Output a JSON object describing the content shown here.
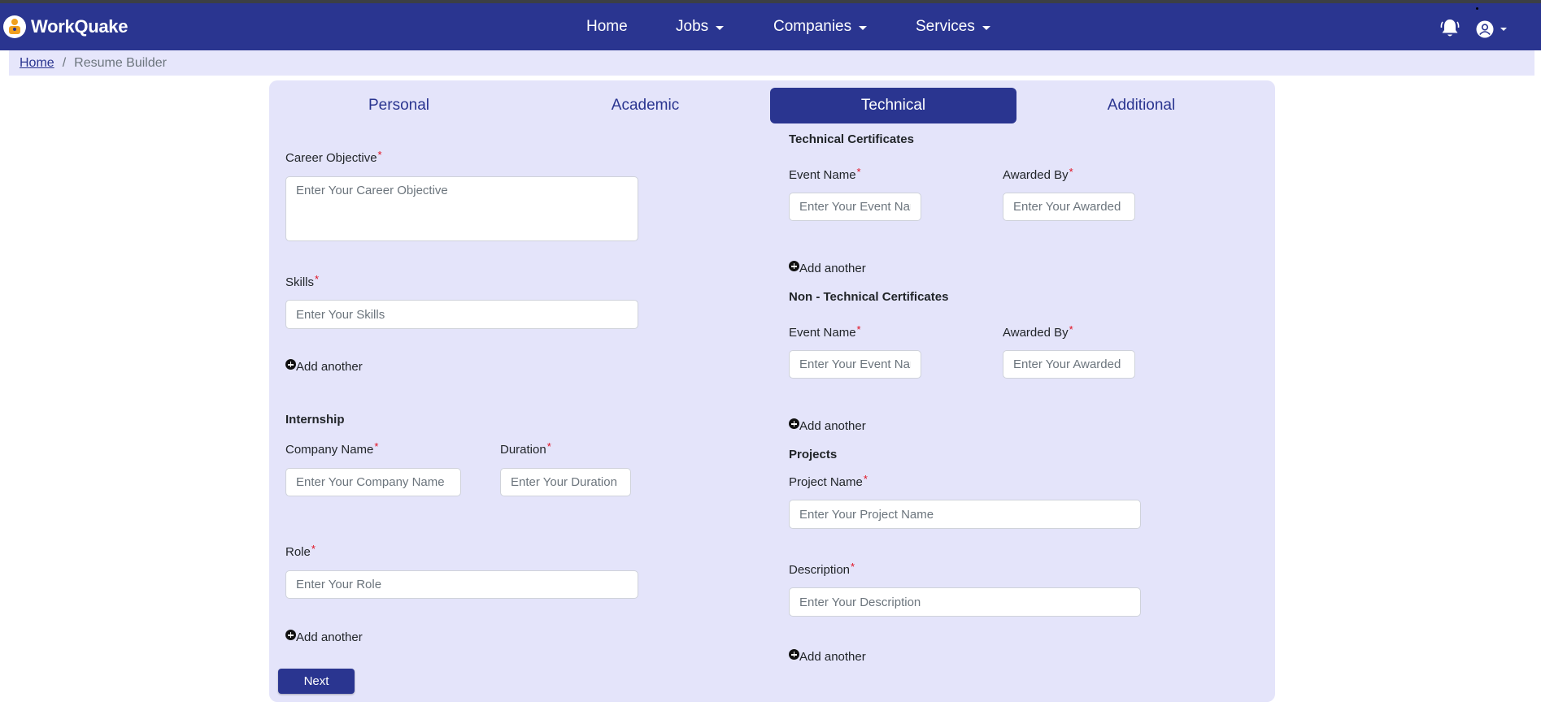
{
  "brand": {
    "name": "WorkQuake"
  },
  "nav": {
    "home": "Home",
    "jobs": "Jobs",
    "companies": "Companies",
    "services": "Services"
  },
  "breadcrumb": {
    "home": "Home",
    "separator": "/",
    "current": "Resume Builder"
  },
  "tabs": {
    "personal": "Personal",
    "academic": "Academic",
    "technical": "Technical",
    "additional": "Additional",
    "active": "Technical"
  },
  "form": {
    "career_objective": {
      "label": "Career Objective",
      "required": "*",
      "placeholder": "Enter Your Career Objective"
    },
    "skills": {
      "label": "Skills",
      "required": "*",
      "placeholder": "Enter Your Skills"
    },
    "add_another": "Add another",
    "internship": {
      "title": "Internship",
      "company_name": {
        "label": "Company Name",
        "required": "*",
        "placeholder": "Enter Your Company Name"
      },
      "duration": {
        "label": "Duration",
        "required": "*",
        "placeholder": "Enter Your Duration"
      },
      "role": {
        "label": "Role",
        "required": "*",
        "placeholder": "Enter Your Role"
      }
    },
    "technical_certificates": {
      "title": "Technical Certificates",
      "event_name": {
        "label": "Event Name",
        "required": "*",
        "placeholder": "Enter Your Event Name"
      },
      "awarded_by": {
        "label": "Awarded By",
        "required": "*",
        "placeholder": "Enter Your Awarded By"
      }
    },
    "non_technical_certificates": {
      "title": "Non - Technical Certificates",
      "event_name": {
        "label": "Event Name",
        "required": "*",
        "placeholder": "Enter Your Event Name"
      },
      "awarded_by": {
        "label": "Awarded By",
        "required": "*",
        "placeholder": "Enter Your Awarded By"
      }
    },
    "projects": {
      "title": "Projects",
      "project_name": {
        "label": "Project Name",
        "required": "*",
        "placeholder": "Enter Your Project Name"
      },
      "description": {
        "label": "Description",
        "required": "*",
        "placeholder": "Enter Your Description"
      }
    },
    "next_button": "Next"
  },
  "colors": {
    "primary": "#2a3590",
    "panel": "#e4e4fa",
    "breadcrumb_bg": "#e6e6fb",
    "required": "#e01020"
  },
  "icons": {
    "notification": "bell-icon",
    "account": "user-circle-icon",
    "add": "plus-circle-icon"
  }
}
